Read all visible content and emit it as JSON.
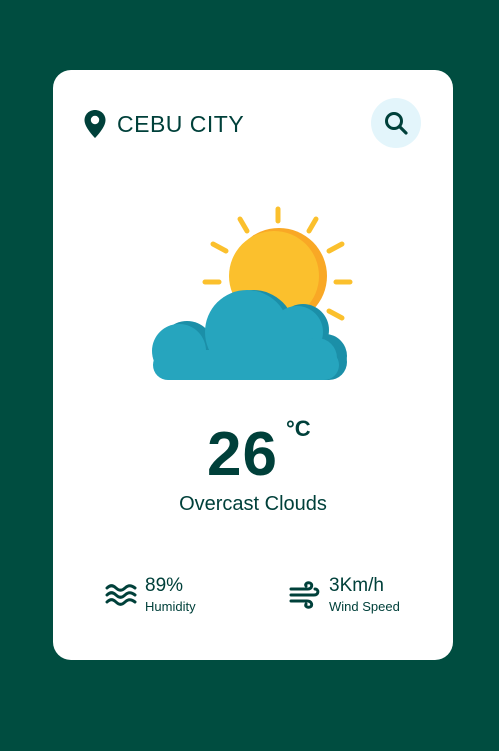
{
  "colors": {
    "background": "#004d40",
    "card": "#ffffff",
    "text": "#00403a",
    "search_bg": "#e3f5fb",
    "sun": "#fbc02d",
    "sun_shade": "#f9a825",
    "cloud": "#26a5be",
    "cloud_shade": "#1b8fa8"
  },
  "header": {
    "location_icon": "map-pin-icon",
    "city": "CEBU CITY",
    "search_icon": "search-icon"
  },
  "current": {
    "icon": "sun-behind-cloud-icon",
    "temperature": "26",
    "unit": "°C",
    "description": "Overcast Clouds"
  },
  "details": {
    "humidity": {
      "icon": "humidity-waves-icon",
      "value": "89%",
      "label": "Humidity"
    },
    "wind": {
      "icon": "wind-icon",
      "value": "3Km/h",
      "label": "Wind Speed"
    }
  }
}
